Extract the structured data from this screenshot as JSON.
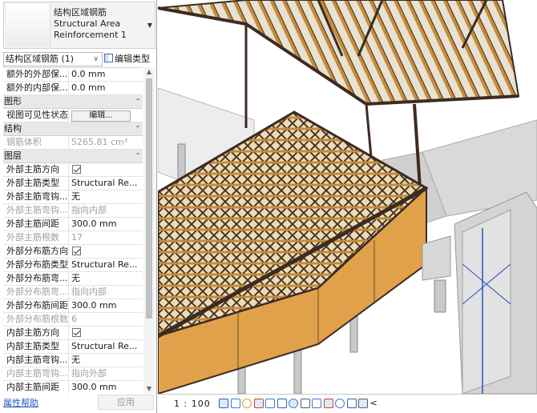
{
  "type_selector": {
    "line1": "结构区域钢筋",
    "line2": "Structural Area",
    "line3": "Reinforcement 1"
  },
  "instance_filter": "结构区域钢筋 (1)",
  "edit_type_label": "编辑类型",
  "rows": [
    {
      "kind": "prop",
      "label": "额外的外部保...",
      "value": "0.0 mm",
      "enabled": true
    },
    {
      "kind": "prop",
      "label": "额外的内部保...",
      "value": "0.0 mm",
      "enabled": true
    },
    {
      "kind": "group",
      "label": "图形"
    },
    {
      "kind": "button",
      "label": "视图可见性状态",
      "value": "编辑..."
    },
    {
      "kind": "group",
      "label": "结构"
    },
    {
      "kind": "prop",
      "label": "钢筋体积",
      "value": "5265.81 cm³",
      "enabled": false
    },
    {
      "kind": "group",
      "label": "图层"
    },
    {
      "kind": "check",
      "label": "外部主筋方向",
      "enabled": true
    },
    {
      "kind": "prop",
      "label": "外部主筋类型",
      "value": "Structural Re...",
      "enabled": true
    },
    {
      "kind": "prop",
      "label": "外部主筋弯钩...",
      "value": "无",
      "enabled": true
    },
    {
      "kind": "prop",
      "label": "外部主筋弯钩...",
      "value": "指向内部",
      "enabled": false
    },
    {
      "kind": "prop",
      "label": "外部主筋间距",
      "value": "300.0 mm",
      "enabled": true
    },
    {
      "kind": "prop",
      "label": "外部主筋根数",
      "value": "17",
      "enabled": false
    },
    {
      "kind": "check",
      "label": "外部分布筋方向",
      "enabled": true
    },
    {
      "kind": "prop",
      "label": "外部分布筋类型",
      "value": "Structural Re...",
      "enabled": true
    },
    {
      "kind": "prop",
      "label": "外部分布筋弯...",
      "value": "无",
      "enabled": true
    },
    {
      "kind": "prop",
      "label": "外部分布筋弯...",
      "value": "指向内部",
      "enabled": false
    },
    {
      "kind": "prop",
      "label": "外部分布筋间距",
      "value": "300.0 mm",
      "enabled": true
    },
    {
      "kind": "prop",
      "label": "外部分布筋根数",
      "value": "6",
      "enabled": false
    },
    {
      "kind": "check",
      "label": "内部主筋方向",
      "enabled": true
    },
    {
      "kind": "prop",
      "label": "内部主筋类型",
      "value": "Structural Re...",
      "enabled": true
    },
    {
      "kind": "prop",
      "label": "内部主筋弯钩...",
      "value": "无",
      "enabled": true
    },
    {
      "kind": "prop",
      "label": "内部主筋弯钩...",
      "value": "指向外部",
      "enabled": false
    },
    {
      "kind": "prop",
      "label": "内部主筋间距",
      "value": "300.0 mm",
      "enabled": true
    }
  ],
  "footer": {
    "help_link": "属性帮助",
    "apply_label": "应用"
  },
  "statusbar": {
    "scale": "1 : 100",
    "icons": [
      "detail-level-icon",
      "visual-style-icon",
      "sun-path-icon",
      "shadows-icon",
      "render-icon",
      "crop-view-icon",
      "show-crop-icon",
      "unlock-3d-icon",
      "temporary-hide-icon",
      "reveal-hidden-icon",
      "worksharing-icon",
      "analytical-model-icon",
      "highlight-boundary-icon",
      "more-icon"
    ]
  },
  "colors": {
    "steel": "#4a3327",
    "timber": "#c68c3a",
    "plywood": "#e0a14a",
    "wall": "#d9d9d9",
    "panel_accent": "#1f55c4"
  }
}
